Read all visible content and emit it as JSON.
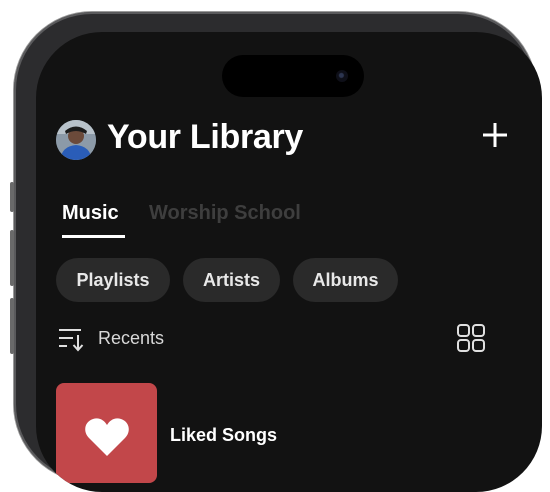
{
  "header": {
    "title": "Your Library"
  },
  "tabs": [
    {
      "label": "Music",
      "active": true
    },
    {
      "label": "Worship School",
      "active": false
    }
  ],
  "filters": [
    "Playlists",
    "Artists",
    "Albums"
  ],
  "sort": {
    "label": "Recents"
  },
  "library_items": [
    {
      "title": "Liked Songs",
      "icon": "heart-icon",
      "art_color": "#c2474a"
    }
  ],
  "colors": {
    "background": "#121212",
    "chip_background": "#2a2a2a",
    "liked_songs_art": "#c2474a",
    "inactive_tab": "#3e3e3e"
  }
}
